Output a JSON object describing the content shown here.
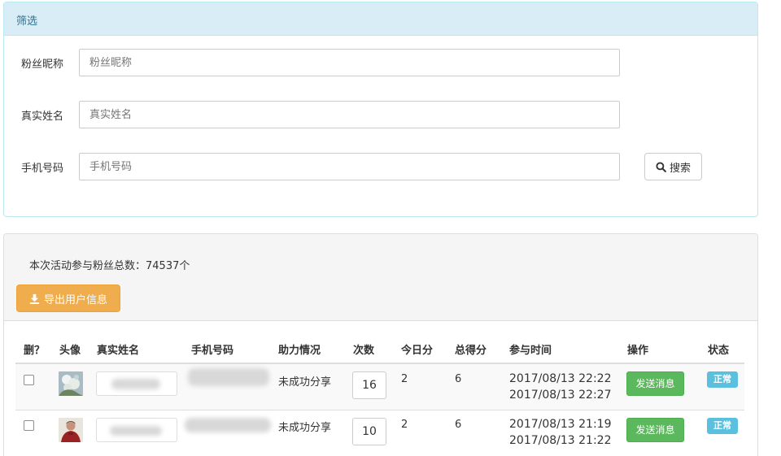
{
  "filter": {
    "title": "筛选",
    "fields": [
      {
        "label": "粉丝昵称",
        "placeholder": "粉丝昵称",
        "value": ""
      },
      {
        "label": "真实姓名",
        "placeholder": "真实姓名",
        "value": ""
      },
      {
        "label": "手机号码",
        "placeholder": "手机号码",
        "value": ""
      }
    ],
    "search_label": "搜索",
    "search_icon": "search-icon"
  },
  "list": {
    "summary": "本次活动参与粉丝总数：74537个",
    "export_label": "导出用户信息",
    "export_icon": "download-icon",
    "columns": [
      "删？",
      "头像",
      "真实姓名",
      "手机号码",
      "助力情况",
      "次数",
      "今日分",
      "总得分",
      "参与时间",
      "操作",
      "状态"
    ],
    "rows": [
      {
        "help_status": "未成功分享",
        "count": "16",
        "today_score": "2",
        "total_score": "6",
        "time_start": "2017/08/13 22:22",
        "time_end": "2017/08/13 22:27",
        "action": "发送消息",
        "status": "正常"
      },
      {
        "help_status": "未成功分享",
        "count": "10",
        "today_score": "2",
        "total_score": "6",
        "time_start": "2017/08/13 21:19",
        "time_end": "2017/08/13 21:22",
        "action": "发送消息",
        "status": "正常"
      }
    ]
  },
  "colors": {
    "info_bg": "#d9edf7",
    "info_text": "#31708f",
    "warning": "#f0ad4e",
    "success": "#5cb85c",
    "badge_info": "#5bc0de"
  }
}
